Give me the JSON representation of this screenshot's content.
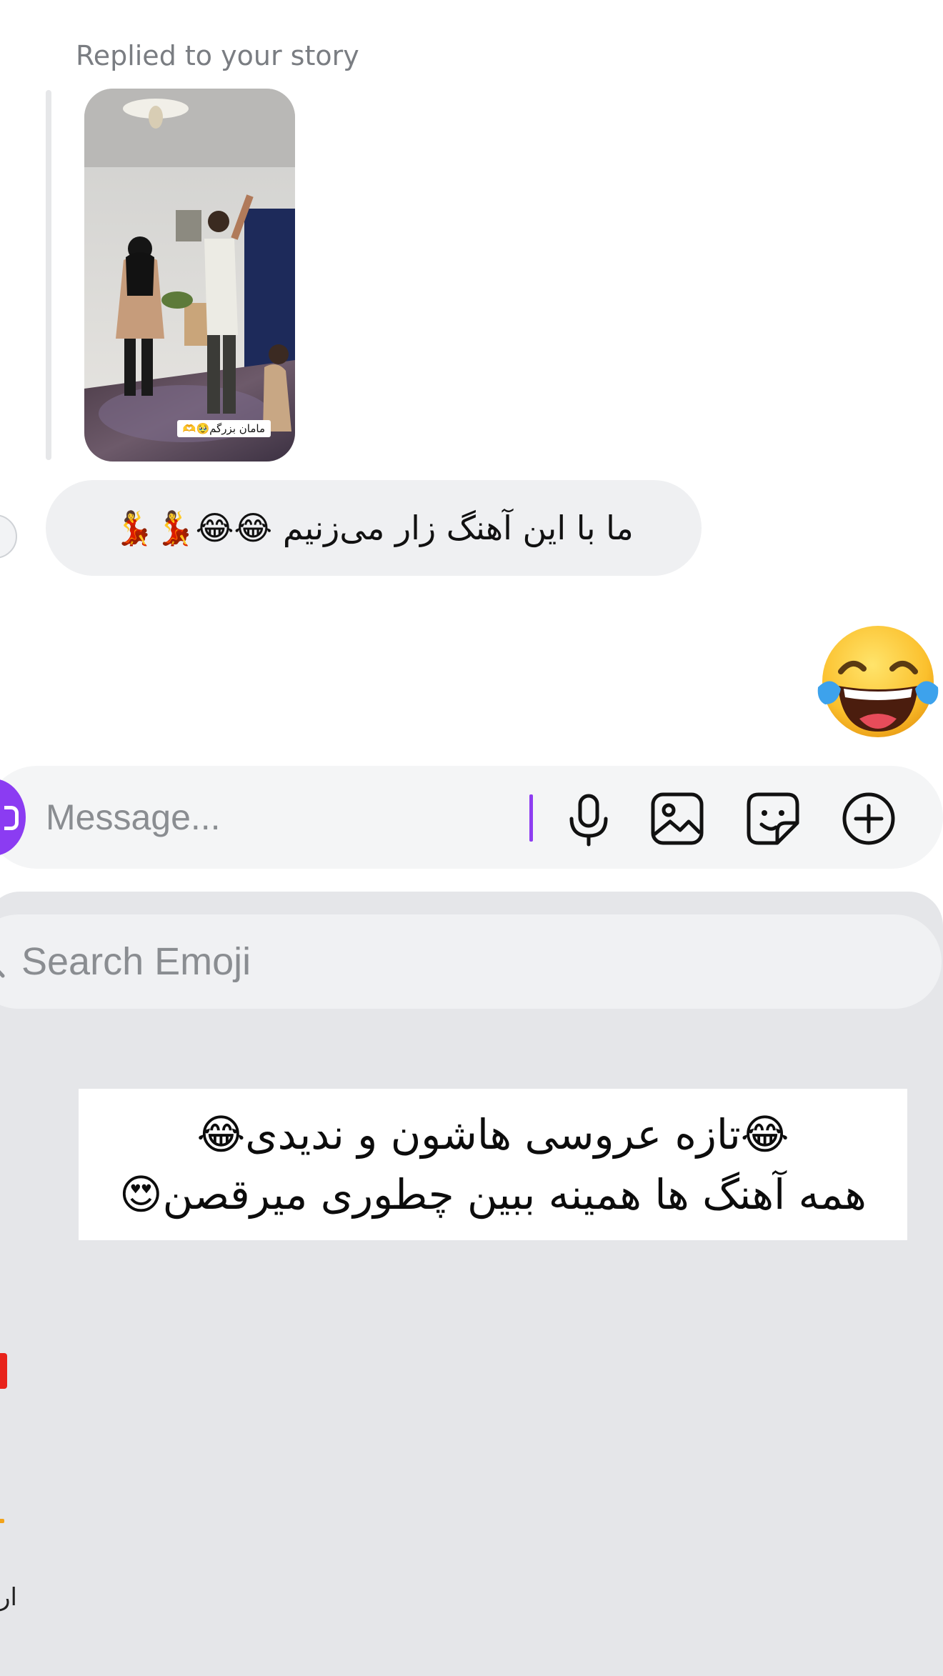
{
  "conversation": {
    "reply_label": "Replied to your story",
    "story": {
      "caption": "مامان بزرگم🥹🫶"
    },
    "incoming_message": "ما با این آهنگ زار می‌زنیم 😂😂💃💃",
    "outgoing_emoji": "😂"
  },
  "composer": {
    "placeholder": "Message...",
    "value": "",
    "icons": [
      "camera-icon",
      "microphone-icon",
      "gallery-icon",
      "sticker-icon",
      "plus-icon"
    ]
  },
  "emoji_keyboard": {
    "search_placeholder": "Search Emoji",
    "sticker_lines": [
      "😂تازه عروسی هاشون و ندیدی😂",
      "همه آهنگ ها همینه ببین چطوری میرقصن😍"
    ],
    "edge_text": "ار"
  },
  "colors": {
    "accent": "#8e3df1",
    "bubble": "#eff0f2",
    "panel": "#e5e6e9",
    "text_muted": "#8a8d91"
  }
}
